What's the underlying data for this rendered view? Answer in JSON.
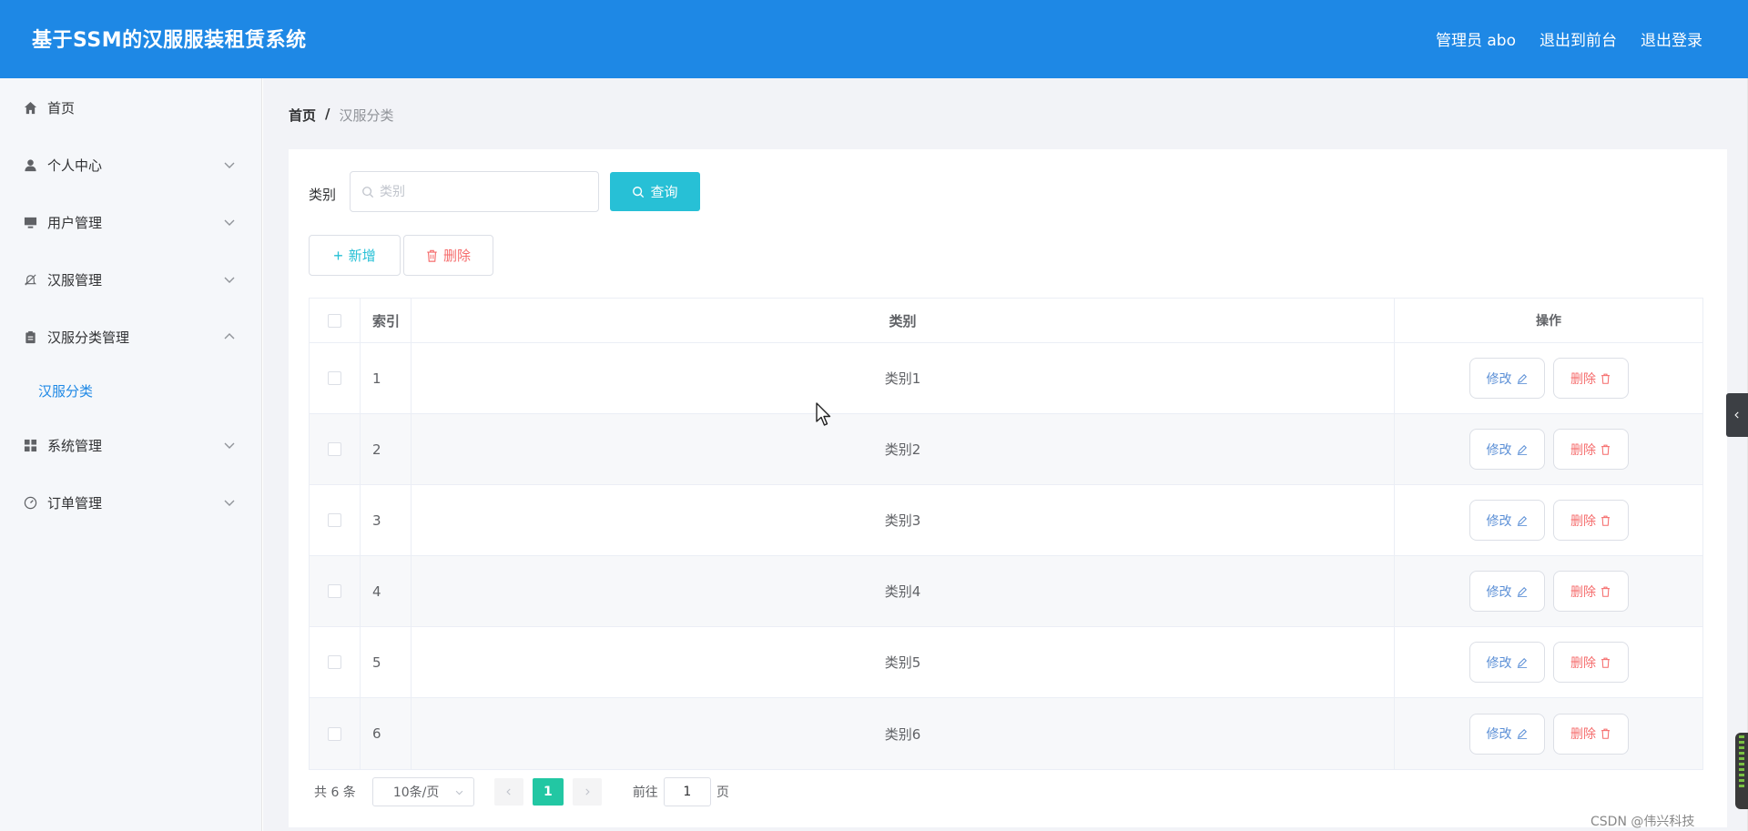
{
  "header": {
    "title": "基于SSM的汉服服装租赁系统",
    "user_label": "管理员 abo",
    "front_link": "退出到前台",
    "logout_link": "退出登录"
  },
  "sidebar": {
    "items": [
      {
        "label": "首页",
        "icon": "home-icon"
      },
      {
        "label": "个人中心",
        "icon": "user-icon"
      },
      {
        "label": "用户管理",
        "icon": "monitor-icon"
      },
      {
        "label": "汉服管理",
        "icon": "bell-off-icon"
      },
      {
        "label": "汉服分类管理",
        "icon": "clipboard-icon"
      },
      {
        "label": "系统管理",
        "icon": "grid-icon"
      },
      {
        "label": "订单管理",
        "icon": "gauge-icon"
      }
    ],
    "sub_active": "汉服分类"
  },
  "breadcrumb": {
    "home": "首页",
    "sep": "/",
    "current": "汉服分类"
  },
  "search": {
    "label": "类别",
    "placeholder": "类别",
    "button": "查询"
  },
  "toolbar": {
    "add": "新增",
    "delete": "删除"
  },
  "table": {
    "headers": {
      "index": "索引",
      "category": "类别",
      "action": "操作"
    },
    "rows": [
      {
        "index": "1",
        "category": "类别1"
      },
      {
        "index": "2",
        "category": "类别2"
      },
      {
        "index": "3",
        "category": "类别3"
      },
      {
        "index": "4",
        "category": "类别4"
      },
      {
        "index": "5",
        "category": "类别5"
      },
      {
        "index": "6",
        "category": "类别6"
      }
    ],
    "edit_label": "修改",
    "delete_label": "删除"
  },
  "pagination": {
    "total": "共 6 条",
    "page_size": "10条/页",
    "current": "1",
    "goto_prefix": "前往",
    "goto_value": "1",
    "goto_suffix": "页"
  },
  "watermark": "CSDN @伟兴科技",
  "colors": {
    "header": "#1e88e5",
    "query": "#27c0d6",
    "page_active": "#22c7a3",
    "danger": "#f56c6c"
  }
}
